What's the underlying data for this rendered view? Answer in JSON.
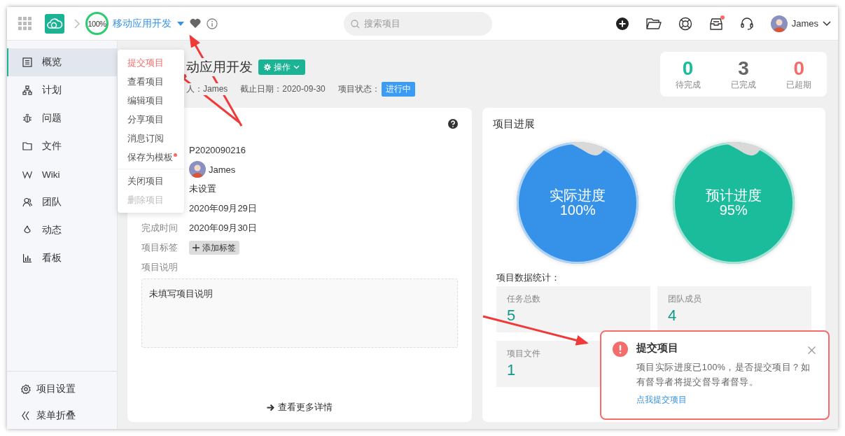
{
  "topbar": {
    "progress": "100%",
    "project_name": "移动应用开发",
    "search": {
      "placeholder": "搜索项目"
    },
    "notification_dot": true,
    "user": "James"
  },
  "sidebar": {
    "items": [
      {
        "label": "概览",
        "selected": true
      },
      {
        "label": "计划",
        "selected": false
      },
      {
        "label": "问题",
        "selected": false
      },
      {
        "label": "文件",
        "selected": false
      },
      {
        "label": "Wiki",
        "selected": false
      },
      {
        "label": "团队",
        "selected": false
      },
      {
        "label": "动态",
        "selected": false
      },
      {
        "label": "看板",
        "selected": false
      }
    ],
    "bottom": [
      {
        "label": "项目设置"
      },
      {
        "label": "菜单折叠"
      }
    ]
  },
  "dropdown": [
    {
      "kind": "item",
      "label": "提交项目",
      "selected": true,
      "disabled": false,
      "dot": false
    },
    {
      "kind": "item",
      "label": "查看项目",
      "selected": false,
      "disabled": false,
      "dot": false
    },
    {
      "kind": "item",
      "label": "编辑项目",
      "selected": false,
      "disabled": false,
      "dot": false
    },
    {
      "kind": "item",
      "label": "分享项目",
      "selected": false,
      "disabled": false,
      "dot": false
    },
    {
      "kind": "item",
      "label": "消息订阅",
      "selected": false,
      "disabled": false,
      "dot": false
    },
    {
      "kind": "item",
      "label": "保存为模板",
      "selected": false,
      "disabled": false,
      "dot": true
    },
    {
      "kind": "divider"
    },
    {
      "kind": "item",
      "label": "关闭项目",
      "selected": false,
      "disabled": false,
      "dot": false
    },
    {
      "kind": "item",
      "label": "删除项目",
      "selected": false,
      "disabled": true,
      "dot": false
    }
  ],
  "header": {
    "title": "动应用开发",
    "action": "操作",
    "meta": [
      {
        "text": "人：James"
      },
      {
        "text": "截止日期：2020-09-30"
      },
      {
        "text": "项目状态："
      }
    ],
    "status": "进行中"
  },
  "summary": [
    {
      "value": "0",
      "label": "待完成",
      "color": "#1abc9c"
    },
    {
      "value": "3",
      "label": "已完成",
      "color": "#666666"
    },
    {
      "value": "0",
      "label": "已超期",
      "color": "#f56c6c"
    }
  ],
  "info_card": {
    "rows": [
      {
        "label": "",
        "value": "P2020090216",
        "kind": "text"
      },
      {
        "label": "",
        "value": "James",
        "kind": "user"
      },
      {
        "label": "",
        "value": "未设置",
        "kind": "text"
      },
      {
        "label": "",
        "value": "2020年09月29日",
        "kind": "text"
      },
      {
        "label": "完成时间",
        "value": "2020年09月30日",
        "kind": "text"
      },
      {
        "label": "项目标签",
        "value": "添加标签",
        "kind": "tag"
      }
    ],
    "description_label": "项目说明",
    "description": "未填写项目说明",
    "more": "查看更多详情"
  },
  "progress_card": {
    "title": "项目进展",
    "circles": [
      {
        "label": "实际进度",
        "value": "100%",
        "color": "#3592e8"
      },
      {
        "label": "预计进度",
        "value": "95%",
        "color": "#1abc9c"
      }
    ],
    "stats_title": "项目数据统计：",
    "stats": [
      {
        "label": "任务总数",
        "value": "5"
      },
      {
        "label": "团队成员",
        "value": "4"
      },
      {
        "label": "项目文件",
        "value": "1"
      }
    ]
  },
  "toast": {
    "title": "提交项目",
    "message": "项目实际进度已100%，是否提交项目？如有督导者将提交督导者督导。",
    "link": "点我提交项目"
  }
}
